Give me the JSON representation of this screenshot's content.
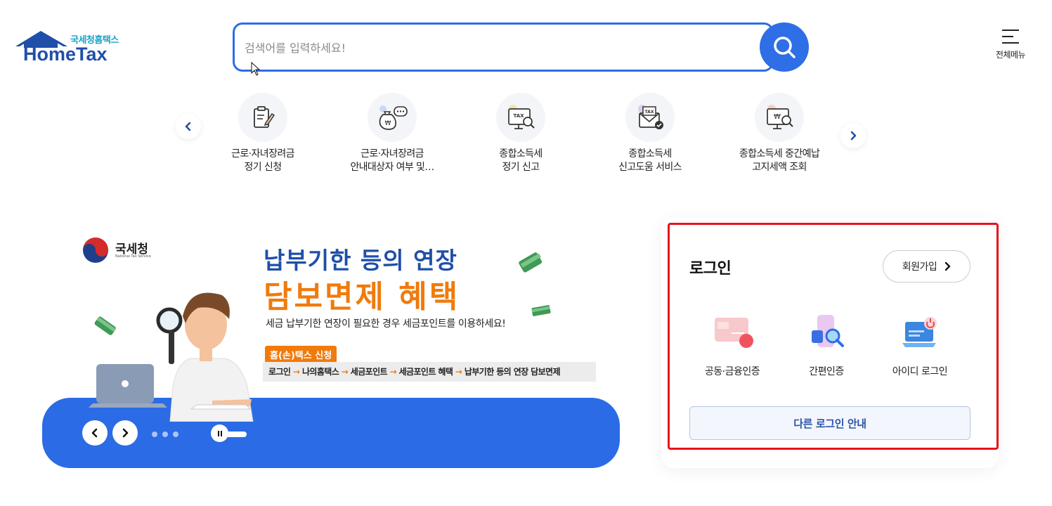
{
  "header": {
    "logo_sub": "국세청홈택스",
    "logo_main": "HomeTax",
    "search_placeholder": "검색어를 입력하세요!",
    "menu_label": "전체메뉴"
  },
  "quick_services": [
    {
      "line1": "근로·자녀장려금",
      "line2": "정기 신청",
      "icon": "clipboard-pen-icon"
    },
    {
      "line1": "근로·자녀장려금",
      "line2": "안내대상자 여부 및…",
      "icon": "money-bag-chat-icon"
    },
    {
      "line1": "종합소득세",
      "line2": "정기 신고",
      "icon": "tax-monitor-search-icon"
    },
    {
      "line1": "종합소득세",
      "line2": "신고도움 서비스",
      "icon": "tax-envelope-check-icon"
    },
    {
      "line1": "종합소득세 중간예납",
      "line2": "고지세액 조회",
      "icon": "won-monitor-search-icon"
    }
  ],
  "banner": {
    "agency": "국세청",
    "agency_en": "National Tax Service",
    "title1": "납부기한 등의 연장",
    "title2": "담보면제 혜택",
    "subtitle": "세금 납부기한 연장이 필요한 경우 세금포인트를 이용하세요!",
    "tag": "홈(손)택스 신청",
    "path": [
      "로그인",
      "나의홈택스",
      "세금포인트",
      "세금포인트 혜택",
      "납부기한 등의 연장 담보면제"
    ],
    "slide_index": 4,
    "slide_count": 4
  },
  "login": {
    "title": "로그인",
    "signup_label": "회원가입",
    "options": [
      {
        "label": "공동·금융인증",
        "icon": "certificate-icon"
      },
      {
        "label": "간편인증",
        "icon": "simple-auth-icon"
      },
      {
        "label": "아이디 로그인",
        "icon": "id-login-laptop-icon"
      }
    ],
    "other_label": "다른 로그인 안내"
  },
  "colors": {
    "brand_blue": "#2e6ee6",
    "accent_orange": "#f07b0c",
    "highlight_red": "#e8131c"
  }
}
